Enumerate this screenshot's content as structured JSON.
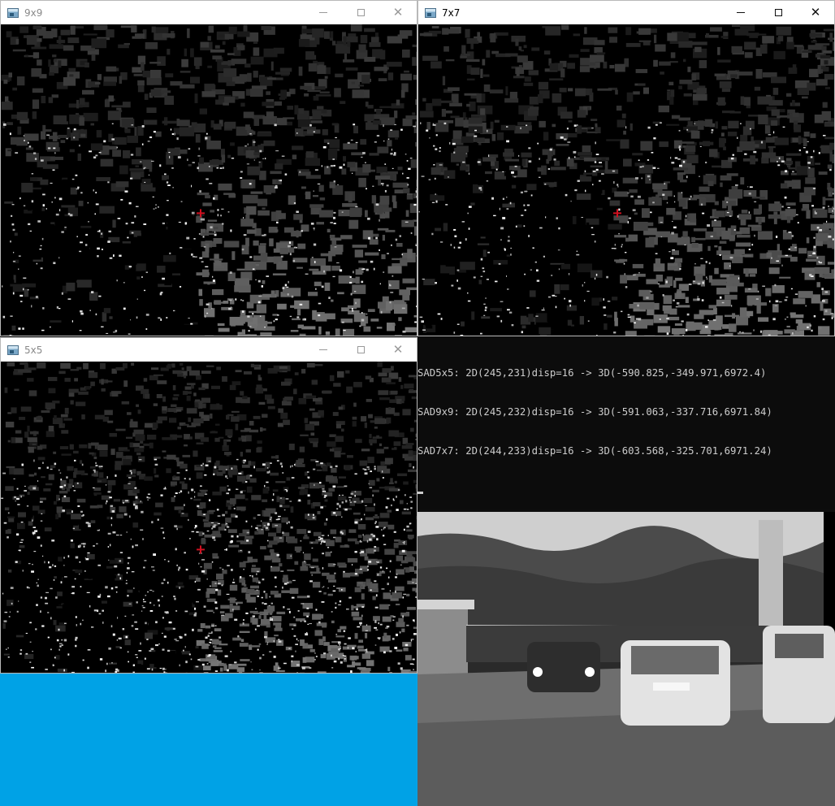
{
  "windows": [
    {
      "id": "win-9x9",
      "title": "9x9",
      "active": false
    },
    {
      "id": "win-7x7",
      "title": "7x7",
      "active": true
    },
    {
      "id": "win-5x5",
      "title": "5x5",
      "active": false
    }
  ],
  "controls": {
    "minimize": "—",
    "maximize": "☐",
    "close": "✕"
  },
  "console": {
    "lines": [
      "SAD5x5: 2D(245,231)disp=16 -> 3D(-590.825,-349.971,6972.4)",
      "SAD9x9: 2D(245,232)disp=16 -> 3D(-591.063,-337.716,6971.84)",
      "SAD7x7: 2D(244,233)disp=16 -> 3D(-603.568,-325.701,6971.24)"
    ]
  },
  "colors": {
    "desktop": "#00a2e6",
    "console_bg": "#0c0c0c",
    "console_fg": "#cccccc",
    "marker": "#d01020"
  },
  "icons": {
    "app": "opencv-window-icon",
    "minimize": "minimize-icon",
    "maximize": "maximize-icon",
    "close": "close-icon",
    "marker": "crosshair-marker-icon"
  }
}
